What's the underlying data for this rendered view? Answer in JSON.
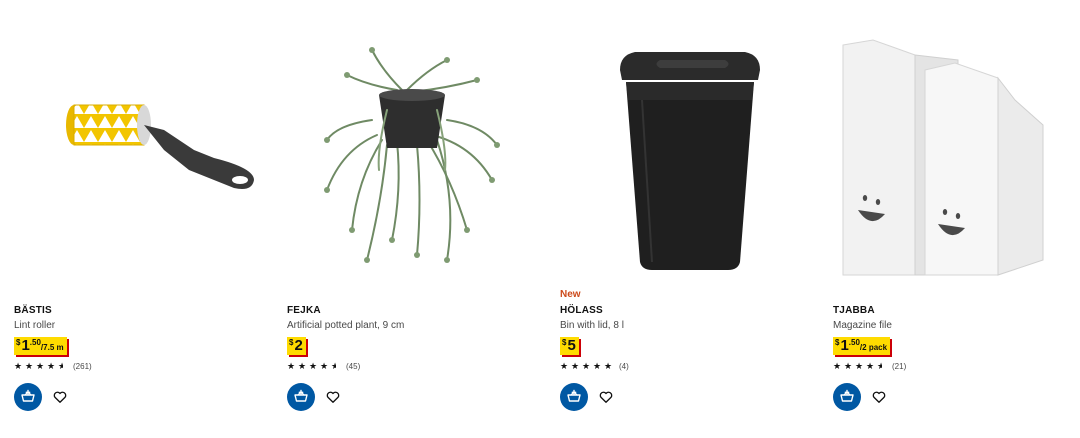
{
  "products": [
    {
      "name": "BÄSTIS",
      "description": "Lint roller",
      "price": {
        "currency": "$",
        "integer": "1",
        "decimal": ".50",
        "unit": "/7.5 m"
      },
      "rating": 4.5,
      "review_count": "(261)",
      "image_icon": "lint-roller-image"
    },
    {
      "name": "FEJKA",
      "description": "Artificial potted plant, 9 cm",
      "price": {
        "currency": "$",
        "integer": "2",
        "decimal": "",
        "unit": ""
      },
      "rating": 4.5,
      "review_count": "(45)",
      "image_icon": "potted-plant-image"
    },
    {
      "badge": "New",
      "name": "HÖLASS",
      "description": "Bin with lid, 8 l",
      "price": {
        "currency": "$",
        "integer": "5",
        "decimal": "",
        "unit": ""
      },
      "rating": 5,
      "review_count": "(4)",
      "image_icon": "waste-bin-image"
    },
    {
      "name": "TJABBA",
      "description": "Magazine file",
      "price": {
        "currency": "$",
        "integer": "1",
        "decimal": ".50",
        "unit": "/2 pack"
      },
      "rating": 4.5,
      "review_count": "(21)",
      "image_icon": "magazine-file-image"
    }
  ],
  "icons": {
    "add_to_cart": "cart-add-icon",
    "favourite": "heart-icon"
  },
  "colors": {
    "price_tag": "#ffdb00",
    "price_shadow": "#cc0008",
    "cart_button": "#0058a3",
    "new_badge": "#cc4a1b"
  }
}
